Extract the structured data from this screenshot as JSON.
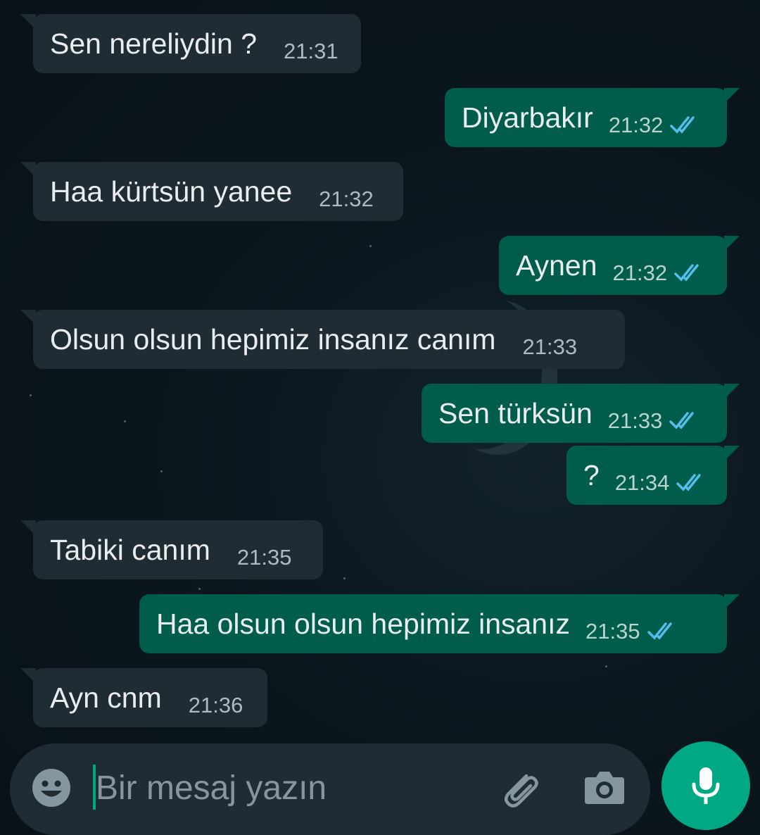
{
  "messages": [
    {
      "direction": "in",
      "text": "Sen nereliydin ?",
      "time": "21:31"
    },
    {
      "direction": "out",
      "text": "Diyarbakır",
      "time": "21:32",
      "status": "read"
    },
    {
      "direction": "in",
      "text": "Haa kürtsün yanee",
      "time": "21:32"
    },
    {
      "direction": "out",
      "text": "Aynen",
      "time": "21:32",
      "status": "read"
    },
    {
      "direction": "in",
      "text": "Olsun olsun hepimiz insanız canım",
      "time": "21:33"
    },
    {
      "direction": "out",
      "text": "Sen türksün",
      "time": "21:33",
      "status": "read"
    },
    {
      "direction": "out",
      "text": "?",
      "time": "21:34",
      "status": "read"
    },
    {
      "direction": "in",
      "text": "Tabiki canım",
      "time": "21:35"
    },
    {
      "direction": "out",
      "text": "Haa olsun olsun hepimiz insanız",
      "time": "21:35",
      "status": "read"
    },
    {
      "direction": "in",
      "text": "Ayn cnm",
      "time": "21:36"
    }
  ],
  "composer": {
    "placeholder": "Bir mesaj yazın",
    "icons": [
      "emoji-icon",
      "attach-icon",
      "camera-icon",
      "mic-icon"
    ]
  },
  "colors": {
    "incoming_bubble": "#1f2c33",
    "outgoing_bubble": "#005c4b",
    "read_ticks": "#53bdeb",
    "accent": "#00a884"
  }
}
